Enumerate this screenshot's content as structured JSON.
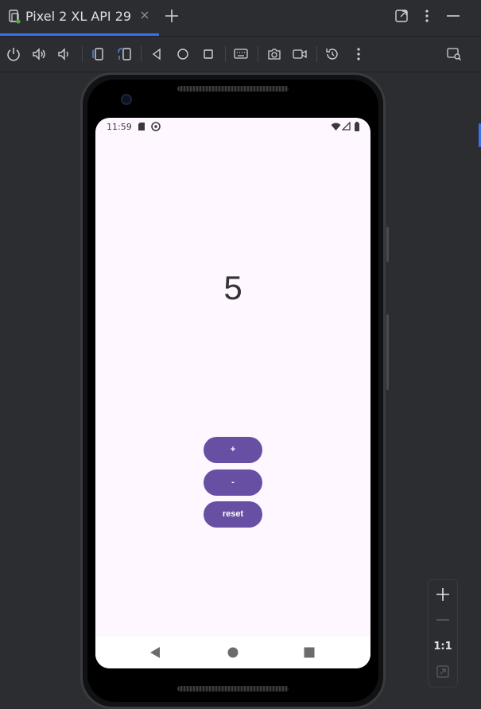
{
  "tab": {
    "title": "Pixel 2 XL API 29"
  },
  "toolbar": {
    "icons": [
      "power-icon",
      "volume-up-icon",
      "volume-down-icon",
      "rotate-left-icon",
      "rotate-right-icon",
      "back-icon",
      "home-icon",
      "overview-icon",
      "keyboard-icon",
      "camera-icon",
      "record-icon",
      "reset-icon",
      "more-icon",
      "screen-search-icon"
    ]
  },
  "device": {
    "status_time": "11:59",
    "counter_value": "5",
    "buttons": {
      "plus": "+",
      "minus": "-",
      "reset": "reset"
    }
  },
  "zoom": {
    "label": "1:1"
  },
  "colors": {
    "accent": "#3574f0",
    "app_button": "#6750a4",
    "screen_bg": "#fef7ff",
    "ide_bg": "#2b2d30"
  }
}
